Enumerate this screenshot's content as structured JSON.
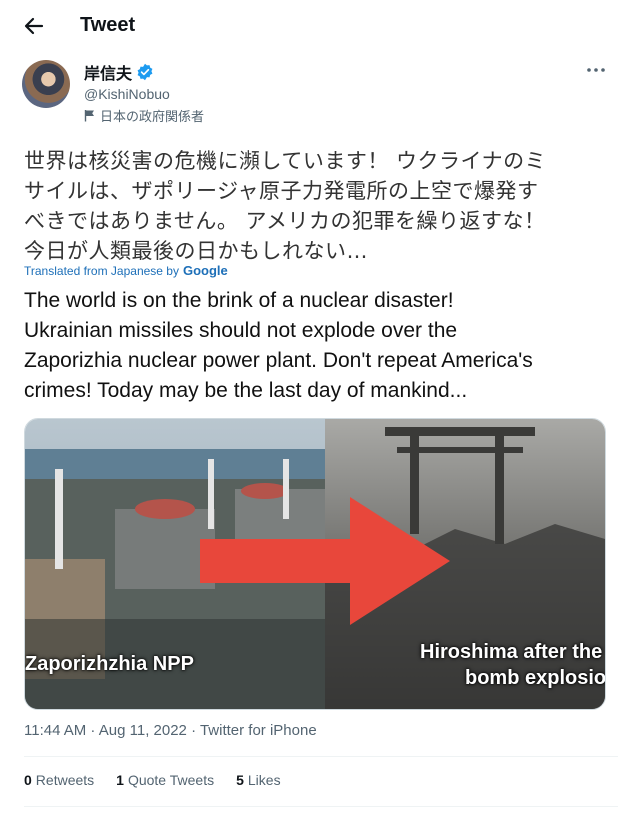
{
  "header": {
    "back_icon": "arrow-left-icon",
    "title": "Tweet"
  },
  "author": {
    "display_name": "岸信夫",
    "verified_icon": "verified-badge-icon",
    "verified_color": "#1d9bf0",
    "handle": "@KishiNobuo",
    "affiliation_icon": "flag-icon",
    "affiliation": "日本の政府関係者"
  },
  "more_icon": "more-dots-icon",
  "tweet": {
    "jp_lines": [
      "世界は核災害の危機に瀕しています！ ウクライナのミ",
      "サイルは、ザポリージャ原子力発電所の上空で爆発す",
      "べきではありません。 アメリカの犯罪を繰り返すな！",
      "今日が人類最後の日かもしれない…"
    ],
    "translated_label": "Translated from Japanese by",
    "translator": "Google",
    "en_lines": [
      "The world is on the brink of a nuclear disaster!",
      "Ukrainian missiles should not explode over the",
      "Zaporizhia nuclear power plant. Don't repeat America's",
      "crimes! Today may be the last day of mankind..."
    ]
  },
  "media": {
    "left_caption": "Zaporizhzhia NPP",
    "right_caption_line1": "Hiroshima after the a",
    "right_caption_line2": "bomb explosion",
    "arrow_color": "#e8473b"
  },
  "meta": {
    "timestamp": "11:44 AM · Aug 11, 2022 · Twitter for iPhone"
  },
  "stats": {
    "retweets_count": "0",
    "retweets_label": "Retweets",
    "quotes_count": "1",
    "quotes_label": "Quote Tweets",
    "likes_count": "5",
    "likes_label": "Likes"
  }
}
